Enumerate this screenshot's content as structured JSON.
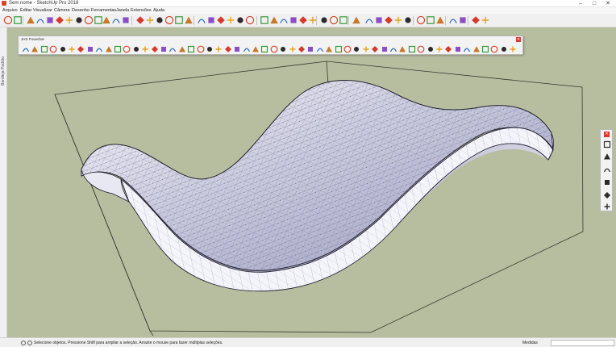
{
  "window": {
    "title": "Sem nome - SketchUp Pro 2018",
    "minimize_glyph": "–",
    "maximize_glyph": "□",
    "close_glyph": "✕"
  },
  "menu": {
    "items": [
      "Arquivo",
      "Editar",
      "Visualizar",
      "Câmera",
      "Desenho",
      "Ferramentas",
      "Janela",
      "Extensões",
      "Ajuda"
    ]
  },
  "toolbar": {
    "icons": [
      "select-icon",
      "eraser-icon",
      "paint-bucket-icon",
      "line-icon",
      "freehand-icon",
      "rectangle-icon",
      "rotated-rectangle-icon",
      "circle-icon",
      "polygon-icon",
      "arc-icon",
      "two-point-arc-icon",
      "three-point-arc-icon",
      "pie-icon",
      "move-icon",
      "push-pull-icon",
      "rotate-icon",
      "follow-me-icon",
      "scale-icon",
      "offset-icon",
      "tape-measure-icon",
      "dimension-icon",
      "protractor-icon",
      "text-icon",
      "axes-icon",
      "3d-text-icon",
      "orbit-icon",
      "pan-icon",
      "zoom-icon",
      "zoom-window-icon",
      "zoom-extents-icon",
      "previous-view-icon",
      "position-camera-icon",
      "walk-icon",
      "look-around-icon",
      "section-plane-icon",
      "sandbox-smoove-icon",
      "sandbox-stamp-icon",
      "sandbox-drape-icon",
      "add-detail-icon",
      "flip-edge-icon",
      "styles-icon",
      "shadows-icon",
      "fog-icon",
      "warehouse-icon",
      "extension-warehouse-icon",
      "model-info-icon",
      "preferences-icon"
    ]
  },
  "sidebar": {
    "label": "Bandeja Padrão"
  },
  "palette": {
    "title": "JHS Powerbar",
    "close_glyph": "✕",
    "tool_count": 54
  },
  "right_panel": {
    "close_glyph": "✕",
    "tools": [
      "tray-tool-1-icon",
      "tray-tool-2-icon",
      "home-icon",
      "tray-tool-4-icon",
      "house-outline-icon",
      "tray-tool-6-icon"
    ]
  },
  "status": {
    "message": "Selecione objetos. Pressione Shift para ampliar a seleção. Arraste o mouse para fazer múltiplas seleções.",
    "measure_label": "Medidas",
    "measure_value": ""
  },
  "colors": {
    "viewport_background": "#b7bd9f",
    "surface_face": "#ececf6",
    "surface_shadow": "#a9aac9",
    "accent_red": "#d63a2a",
    "accent_blue": "#2d6fc7"
  }
}
